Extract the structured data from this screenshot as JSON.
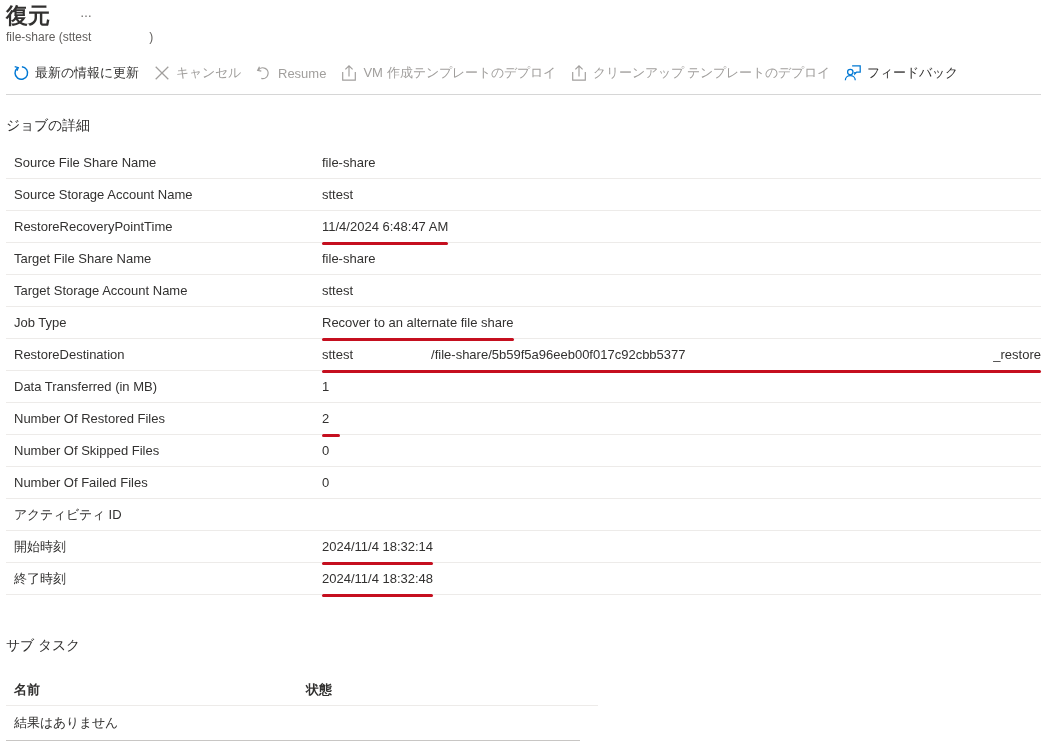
{
  "header": {
    "title": "復元",
    "more": "…",
    "subtitle_parts": [
      "file-share (sttest",
      ")"
    ]
  },
  "toolbar": [
    {
      "kind": "refresh",
      "label": "最新の情報に更新",
      "disabled": false
    },
    {
      "kind": "cancel",
      "label": "キャンセル",
      "disabled": true
    },
    {
      "kind": "undo",
      "label": "Resume",
      "disabled": true
    },
    {
      "kind": "upload",
      "label": "VM 作成テンプレートのデプロイ",
      "disabled": true
    },
    {
      "kind": "upload",
      "label": "クリーンアップ テンプレートのデプロイ",
      "disabled": true
    },
    {
      "kind": "feedback",
      "label": "フィードバック",
      "disabled": false
    }
  ],
  "job_details": {
    "heading": "ジョブの詳細",
    "rows": [
      {
        "label": "Source File Share Name",
        "value": "file-share",
        "underlined": false
      },
      {
        "label": "Source Storage Account Name",
        "value": "sttest",
        "underlined": false
      },
      {
        "label": "RestoreRecoveryPointTime",
        "value": "11/4/2024 6:48:47 AM",
        "underlined": true
      },
      {
        "label": "Target File Share Name",
        "value": "file-share",
        "underlined": false
      },
      {
        "label": "Target Storage Account Name",
        "value": "sttest",
        "underlined": false
      },
      {
        "label": "Job Type",
        "value": "Recover to an alternate file share",
        "underlined": true
      },
      {
        "label": "RestoreDestination",
        "parts": [
          "sttest",
          "/file-share/5b59f5a96eeb00f017c92cbb5377",
          "_restore"
        ],
        "underlined": true
      },
      {
        "label": "Data Transferred (in MB)",
        "value": "1",
        "underlined": false
      },
      {
        "label": "Number Of Restored Files",
        "value": "2",
        "underlined": true
      },
      {
        "label": "Number Of Skipped Files",
        "value": "0",
        "underlined": false
      },
      {
        "label": "Number Of Failed Files",
        "value": "0",
        "underlined": false
      },
      {
        "label": "アクティビティ ID",
        "underlined": false
      },
      {
        "label": "開始時刻",
        "value": "2024/11/4 18:32:14",
        "underlined": true
      },
      {
        "label": "終了時刻",
        "value": "2024/11/4 18:32:48",
        "underlined": true
      }
    ]
  },
  "sub_tasks": {
    "heading": "サブ タスク",
    "columns": [
      "名前",
      "状態"
    ],
    "empty_text": "結果はありません"
  }
}
